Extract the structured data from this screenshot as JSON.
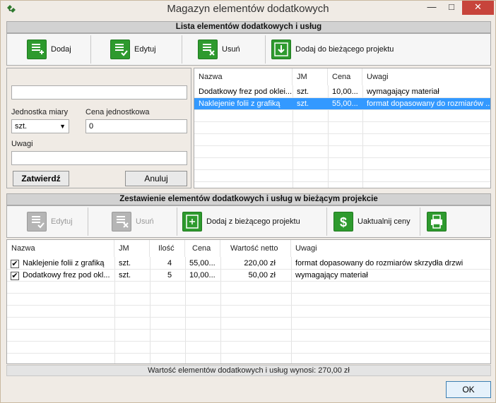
{
  "window": {
    "title": "Magazyn elementów dodatkowych"
  },
  "list_section": {
    "header": "Lista elementów dodatkowych i usług",
    "toolbar": {
      "add": "Dodaj",
      "edit": "Edytuj",
      "delete": "Usuń",
      "add_to_project": "Dodaj do bieżącego projektu"
    }
  },
  "form": {
    "name_value": "",
    "unit_label": "Jednostka miary",
    "unit_value": "szt.",
    "price_label": "Cena jednostkowa",
    "price_value": "0",
    "notes_label": "Uwagi",
    "notes_value": "",
    "confirm": "Zatwierdź",
    "cancel": "Anuluj"
  },
  "list_table": {
    "columns": [
      "Nazwa",
      "JM",
      "Cena",
      "Uwagi"
    ],
    "rows": [
      {
        "name": "Dodatkowy frez pod oklei...",
        "jm": "szt.",
        "price": "10,00...",
        "notes": "wymagający materiał",
        "selected": false
      },
      {
        "name": "Naklejenie folii z grafiką",
        "jm": "szt.",
        "price": "55,00...",
        "notes": "format dopasowany do rozmiarów ...",
        "selected": true
      }
    ]
  },
  "project_section": {
    "header": "Zestawienie elementów dodatkowych i usług w bieżącym projekcie",
    "toolbar": {
      "edit": "Edytuj",
      "delete": "Usuń",
      "add_from_project": "Dodaj z bieżącego projektu",
      "update_prices": "Uaktualnij ceny"
    }
  },
  "project_table": {
    "columns": [
      "Nazwa",
      "JM",
      "Ilość",
      "Cena",
      "Wartość netto",
      "Uwagi"
    ],
    "rows": [
      {
        "checked": true,
        "name": "Naklejenie folii z grafiką",
        "jm": "szt.",
        "qty": "4",
        "price": "55,00...",
        "net": "220,00 zł",
        "notes": "format dopasowany do rozmiarów skrzydła drzwi"
      },
      {
        "checked": true,
        "name": "Dodatkowy frez pod okl...",
        "jm": "szt.",
        "qty": "5",
        "price": "10,00...",
        "net": "50,00 zł",
        "notes": "wymagający materiał"
      }
    ]
  },
  "summary": "Wartość elementów dodatkowych i usług wynosi: 270,00 zł",
  "ok": "OK",
  "colors": {
    "accent_green": "#2e9a2e",
    "selection": "#3399ff",
    "close": "#c7443b"
  }
}
